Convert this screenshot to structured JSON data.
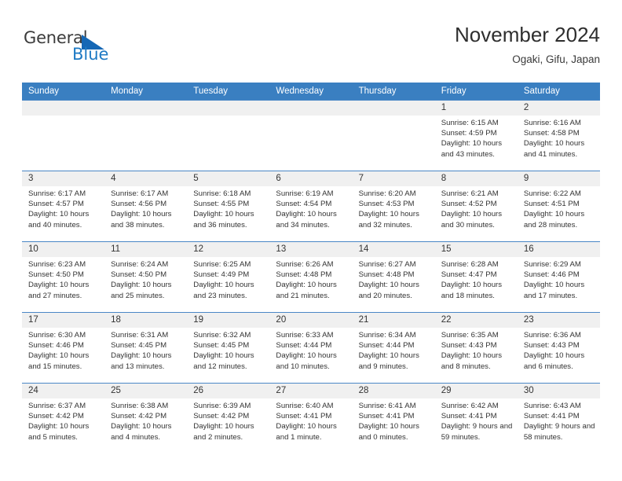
{
  "brand": {
    "name_part1": "General",
    "name_part2": "Blue"
  },
  "header": {
    "title": "November 2024",
    "subtitle": "Ogaki, Gifu, Japan"
  },
  "colors": {
    "header_blue": "#3a7fc1",
    "row_border_blue": "#4a87c6",
    "daynum_bg": "#f0f0f0",
    "brand_blue": "#1e7ac4",
    "text": "#333333"
  },
  "weekdays": [
    "Sunday",
    "Monday",
    "Tuesday",
    "Wednesday",
    "Thursday",
    "Friday",
    "Saturday"
  ],
  "weeks": [
    [
      {
        "day": "",
        "sunrise": "",
        "sunset": "",
        "daylight": ""
      },
      {
        "day": "",
        "sunrise": "",
        "sunset": "",
        "daylight": ""
      },
      {
        "day": "",
        "sunrise": "",
        "sunset": "",
        "daylight": ""
      },
      {
        "day": "",
        "sunrise": "",
        "sunset": "",
        "daylight": ""
      },
      {
        "day": "",
        "sunrise": "",
        "sunset": "",
        "daylight": ""
      },
      {
        "day": "1",
        "sunrise": "Sunrise: 6:15 AM",
        "sunset": "Sunset: 4:59 PM",
        "daylight": "Daylight: 10 hours and 43 minutes."
      },
      {
        "day": "2",
        "sunrise": "Sunrise: 6:16 AM",
        "sunset": "Sunset: 4:58 PM",
        "daylight": "Daylight: 10 hours and 41 minutes."
      }
    ],
    [
      {
        "day": "3",
        "sunrise": "Sunrise: 6:17 AM",
        "sunset": "Sunset: 4:57 PM",
        "daylight": "Daylight: 10 hours and 40 minutes."
      },
      {
        "day": "4",
        "sunrise": "Sunrise: 6:17 AM",
        "sunset": "Sunset: 4:56 PM",
        "daylight": "Daylight: 10 hours and 38 minutes."
      },
      {
        "day": "5",
        "sunrise": "Sunrise: 6:18 AM",
        "sunset": "Sunset: 4:55 PM",
        "daylight": "Daylight: 10 hours and 36 minutes."
      },
      {
        "day": "6",
        "sunrise": "Sunrise: 6:19 AM",
        "sunset": "Sunset: 4:54 PM",
        "daylight": "Daylight: 10 hours and 34 minutes."
      },
      {
        "day": "7",
        "sunrise": "Sunrise: 6:20 AM",
        "sunset": "Sunset: 4:53 PM",
        "daylight": "Daylight: 10 hours and 32 minutes."
      },
      {
        "day": "8",
        "sunrise": "Sunrise: 6:21 AM",
        "sunset": "Sunset: 4:52 PM",
        "daylight": "Daylight: 10 hours and 30 minutes."
      },
      {
        "day": "9",
        "sunrise": "Sunrise: 6:22 AM",
        "sunset": "Sunset: 4:51 PM",
        "daylight": "Daylight: 10 hours and 28 minutes."
      }
    ],
    [
      {
        "day": "10",
        "sunrise": "Sunrise: 6:23 AM",
        "sunset": "Sunset: 4:50 PM",
        "daylight": "Daylight: 10 hours and 27 minutes."
      },
      {
        "day": "11",
        "sunrise": "Sunrise: 6:24 AM",
        "sunset": "Sunset: 4:50 PM",
        "daylight": "Daylight: 10 hours and 25 minutes."
      },
      {
        "day": "12",
        "sunrise": "Sunrise: 6:25 AM",
        "sunset": "Sunset: 4:49 PM",
        "daylight": "Daylight: 10 hours and 23 minutes."
      },
      {
        "day": "13",
        "sunrise": "Sunrise: 6:26 AM",
        "sunset": "Sunset: 4:48 PM",
        "daylight": "Daylight: 10 hours and 21 minutes."
      },
      {
        "day": "14",
        "sunrise": "Sunrise: 6:27 AM",
        "sunset": "Sunset: 4:48 PM",
        "daylight": "Daylight: 10 hours and 20 minutes."
      },
      {
        "day": "15",
        "sunrise": "Sunrise: 6:28 AM",
        "sunset": "Sunset: 4:47 PM",
        "daylight": "Daylight: 10 hours and 18 minutes."
      },
      {
        "day": "16",
        "sunrise": "Sunrise: 6:29 AM",
        "sunset": "Sunset: 4:46 PM",
        "daylight": "Daylight: 10 hours and 17 minutes."
      }
    ],
    [
      {
        "day": "17",
        "sunrise": "Sunrise: 6:30 AM",
        "sunset": "Sunset: 4:46 PM",
        "daylight": "Daylight: 10 hours and 15 minutes."
      },
      {
        "day": "18",
        "sunrise": "Sunrise: 6:31 AM",
        "sunset": "Sunset: 4:45 PM",
        "daylight": "Daylight: 10 hours and 13 minutes."
      },
      {
        "day": "19",
        "sunrise": "Sunrise: 6:32 AM",
        "sunset": "Sunset: 4:45 PM",
        "daylight": "Daylight: 10 hours and 12 minutes."
      },
      {
        "day": "20",
        "sunrise": "Sunrise: 6:33 AM",
        "sunset": "Sunset: 4:44 PM",
        "daylight": "Daylight: 10 hours and 10 minutes."
      },
      {
        "day": "21",
        "sunrise": "Sunrise: 6:34 AM",
        "sunset": "Sunset: 4:44 PM",
        "daylight": "Daylight: 10 hours and 9 minutes."
      },
      {
        "day": "22",
        "sunrise": "Sunrise: 6:35 AM",
        "sunset": "Sunset: 4:43 PM",
        "daylight": "Daylight: 10 hours and 8 minutes."
      },
      {
        "day": "23",
        "sunrise": "Sunrise: 6:36 AM",
        "sunset": "Sunset: 4:43 PM",
        "daylight": "Daylight: 10 hours and 6 minutes."
      }
    ],
    [
      {
        "day": "24",
        "sunrise": "Sunrise: 6:37 AM",
        "sunset": "Sunset: 4:42 PM",
        "daylight": "Daylight: 10 hours and 5 minutes."
      },
      {
        "day": "25",
        "sunrise": "Sunrise: 6:38 AM",
        "sunset": "Sunset: 4:42 PM",
        "daylight": "Daylight: 10 hours and 4 minutes."
      },
      {
        "day": "26",
        "sunrise": "Sunrise: 6:39 AM",
        "sunset": "Sunset: 4:42 PM",
        "daylight": "Daylight: 10 hours and 2 minutes."
      },
      {
        "day": "27",
        "sunrise": "Sunrise: 6:40 AM",
        "sunset": "Sunset: 4:41 PM",
        "daylight": "Daylight: 10 hours and 1 minute."
      },
      {
        "day": "28",
        "sunrise": "Sunrise: 6:41 AM",
        "sunset": "Sunset: 4:41 PM",
        "daylight": "Daylight: 10 hours and 0 minutes."
      },
      {
        "day": "29",
        "sunrise": "Sunrise: 6:42 AM",
        "sunset": "Sunset: 4:41 PM",
        "daylight": "Daylight: 9 hours and 59 minutes."
      },
      {
        "day": "30",
        "sunrise": "Sunrise: 6:43 AM",
        "sunset": "Sunset: 4:41 PM",
        "daylight": "Daylight: 9 hours and 58 minutes."
      }
    ]
  ]
}
